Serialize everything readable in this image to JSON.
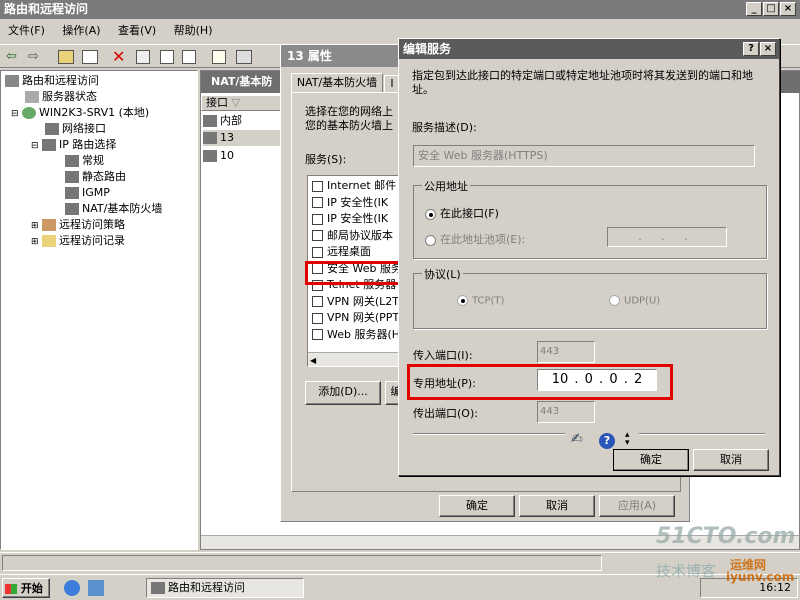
{
  "window": {
    "title": "路由和远程访问"
  },
  "menu": [
    "文件(F)",
    "操作(A)",
    "查看(V)",
    "帮助(H)"
  ],
  "tree": [
    {
      "label": "路由和远程访问"
    },
    {
      "label": "服务器状态"
    },
    {
      "label": "WIN2K3-SRV1 (本地)"
    },
    {
      "label": "网络接口"
    },
    {
      "label": "IP 路由选择"
    },
    {
      "label": "常规"
    },
    {
      "label": "静态路由"
    },
    {
      "label": "IGMP"
    },
    {
      "label": "NAT/基本防火墙"
    },
    {
      "label": "远程访问策略"
    },
    {
      "label": "远程访问记录"
    }
  ],
  "mid": {
    "header": "NAT/基本防",
    "column": "接口",
    "rows": [
      "内部",
      "13",
      "10"
    ]
  },
  "props": {
    "title": "13 属性",
    "tab": "NAT/基本防火墙",
    "tab2": "I",
    "intro1": "选择在您的网络上",
    "intro2": "您的基本防火墙上",
    "services_label": "服务(S):",
    "services": [
      "Internet 邮件",
      "IP 安全性(IK",
      "IP 安全性(IK",
      "邮局协议版本",
      "远程桌面",
      "安全 Web 服务",
      "Telnet 服务器",
      "VPN 网关(L2T",
      "VPN 网关(PPT",
      "Web 服务器(H"
    ],
    "add": "添加(D)...",
    "edit": "编",
    "ok": "确定",
    "cancel": "取消",
    "apply": "应用(A)"
  },
  "edit": {
    "title": "编辑服务",
    "help": "?",
    "close": "×",
    "intro": "指定包到达此接口的特定端口或特定地址池项时将其发送到的端口和地址。",
    "desc_label": "服务描述(D):",
    "desc_value": "安全 Web 服务器(HTTPS)",
    "public_label": "公用地址",
    "opt1": "在此接口(F)",
    "opt2": "在此地址池项(E):",
    "pool_value": ". . .",
    "proto_label": "协议(L)",
    "tcp": "TCP(T)",
    "udp": "UDP(U)",
    "in_label": "传入端口(I):",
    "in_value": "443",
    "priv_label": "专用地址(P):",
    "priv_value": "10 . 0 . 0 . 2",
    "out_label": "传出端口(O):",
    "out_value": "443",
    "ok": "确定",
    "cancel": "取消"
  },
  "taskbar": {
    "start": "开始",
    "task": "路由和远程访问",
    "clock": "16:12"
  },
  "watermark": {
    "line1": "51CTO.com",
    "line2": "技术博客",
    "line3": "运维网",
    "line4": "iyunv.com"
  }
}
